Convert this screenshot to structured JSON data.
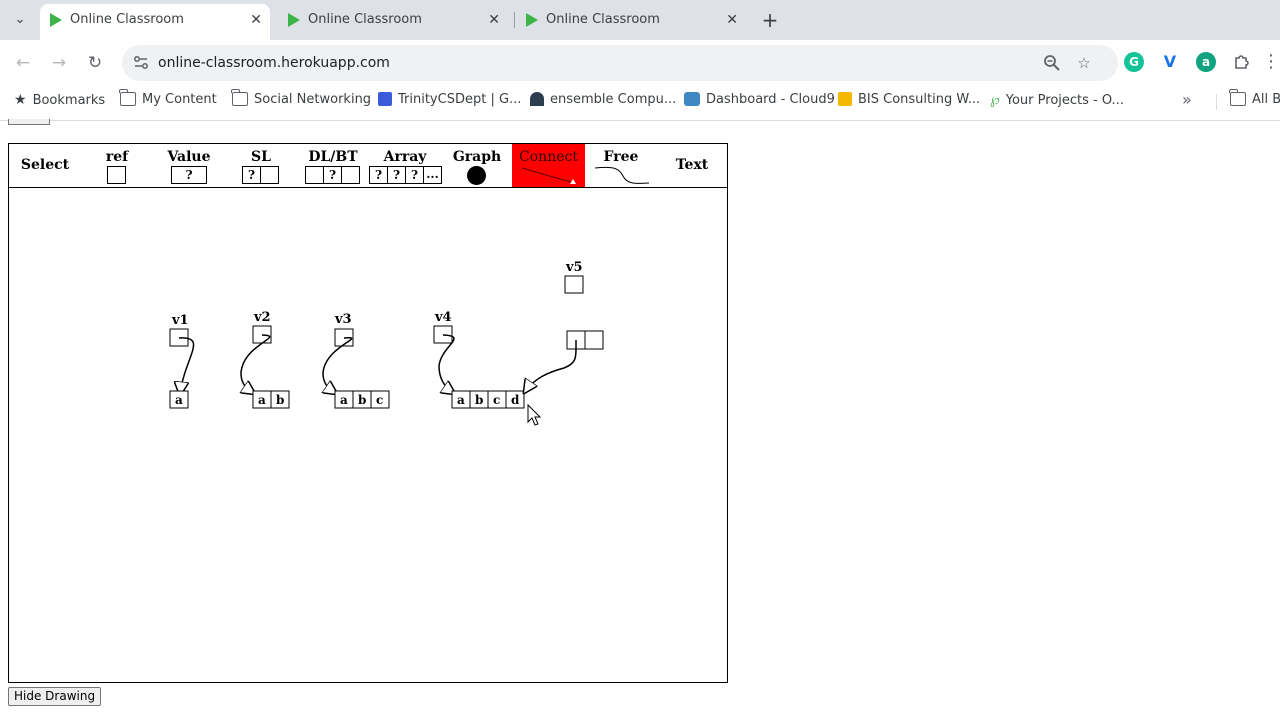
{
  "browser": {
    "tabs": [
      {
        "title": "Online Classroom",
        "active": true
      },
      {
        "title": "Online Classroom",
        "active": false
      },
      {
        "title": "Online Classroom",
        "active": false
      }
    ],
    "new_tab_label": "+",
    "url": "online-classroom.herokuapp.com",
    "bookmarks": [
      {
        "label": "Bookmarks",
        "icon": "star-icon"
      },
      {
        "label": "My Content",
        "icon": "folder-icon"
      },
      {
        "label": "Social Networking",
        "icon": "folder-icon"
      },
      {
        "label": "TrinityCSDept | G...",
        "icon": "trinity-favicon"
      },
      {
        "label": "ensemble Compu...",
        "icon": "ensemble-favicon"
      },
      {
        "label": "Dashboard - Cloud9",
        "icon": "cloud9-favicon"
      },
      {
        "label": "BIS Consulting W...",
        "icon": "bis-favicon"
      },
      {
        "label": "Your Projects - O...",
        "icon": "projects-favicon"
      }
    ],
    "all_bookmarks_label": "All B",
    "colors": {
      "tab_strip": "#dee1e6",
      "favicon": "#3cb44a",
      "grammarly": "#15c39a",
      "vimeo": "#1a73e8"
    }
  },
  "palette": {
    "tools": [
      {
        "label": "Select",
        "cells": []
      },
      {
        "label": "ref",
        "cells": [
          ""
        ]
      },
      {
        "label": "Value",
        "cells": [
          "?"
        ]
      },
      {
        "label": "SL",
        "cells": [
          "?",
          ""
        ]
      },
      {
        "label": "DL/BT",
        "cells": [
          "",
          "?",
          ""
        ]
      },
      {
        "label": "Array",
        "cells": [
          "?",
          "?",
          "?",
          "..."
        ]
      },
      {
        "label": "Graph",
        "cells": []
      },
      {
        "label": "Connect",
        "cells": []
      },
      {
        "label": "Free",
        "cells": []
      },
      {
        "label": "Text",
        "cells": []
      }
    ],
    "selected_tool": "Connect",
    "selected_color": "#ff0000"
  },
  "drawing": {
    "variables": [
      "v1",
      "v2",
      "v3",
      "v4",
      "v5"
    ],
    "arrays": [
      [
        "a"
      ],
      [
        "a",
        "b"
      ],
      [
        "a",
        "b",
        "c"
      ],
      [
        "a",
        "b",
        "c",
        "d"
      ]
    ]
  },
  "buttons": {
    "hide_drawing": "Hide Drawing"
  }
}
